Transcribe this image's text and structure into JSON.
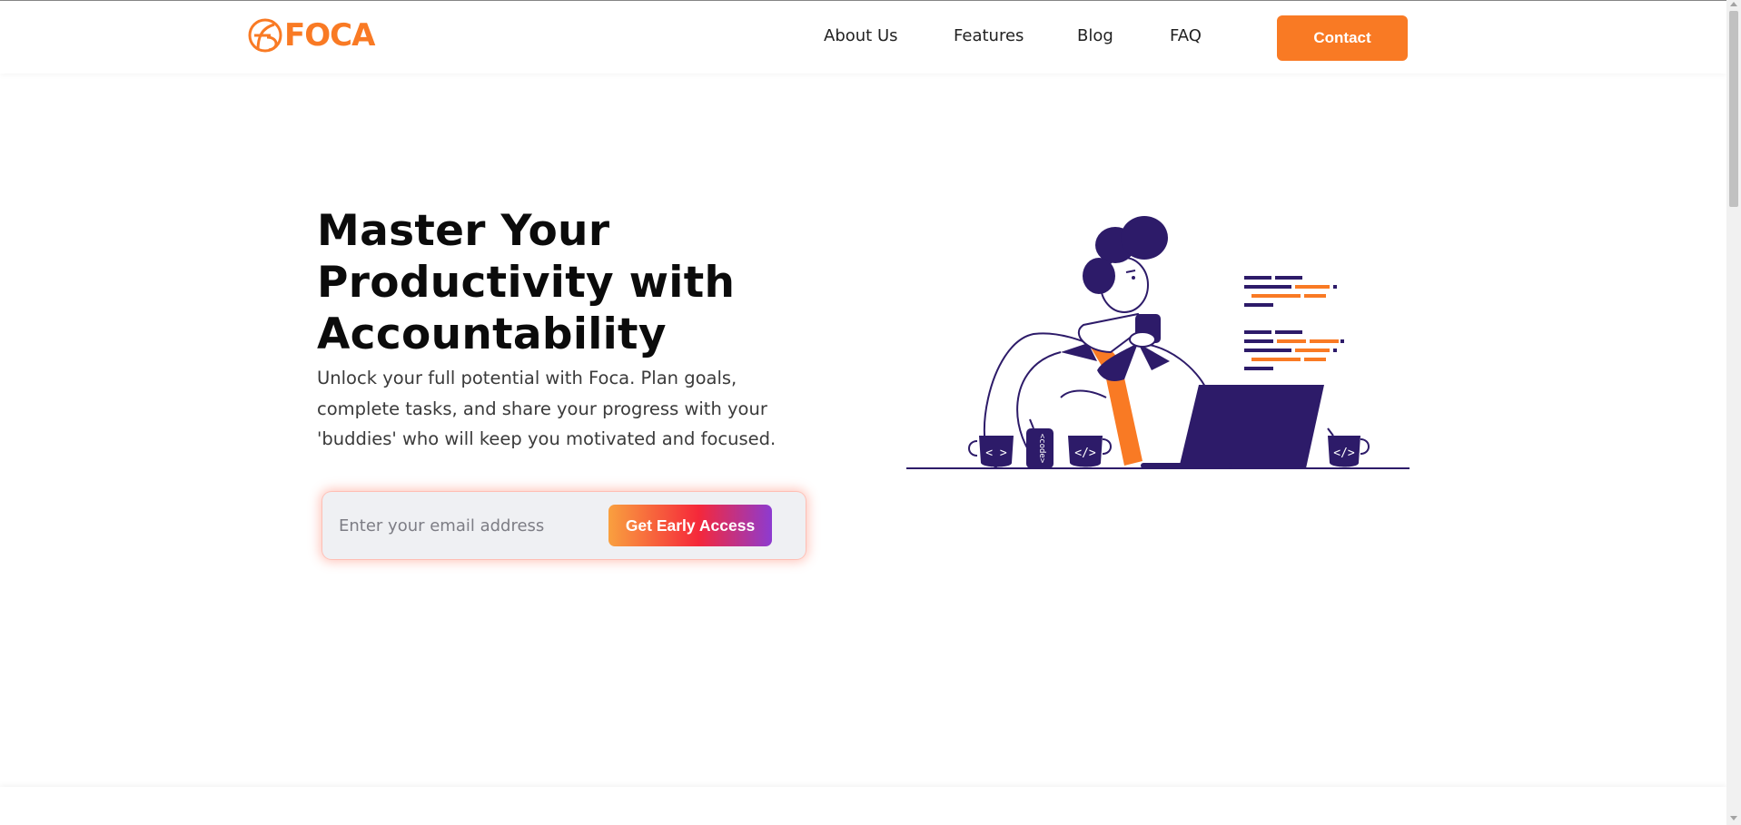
{
  "header": {
    "logo_text": "FOCA",
    "nav": {
      "about": "About Us",
      "features": "Features",
      "blog": "Blog",
      "faq": "FAQ"
    },
    "contact_label": "Contact"
  },
  "hero": {
    "title_lines": [
      "Master Your",
      "Productivity with",
      "Accountability"
    ],
    "subtitle": "Unlock your full potential with Foca. Plan goals, complete tasks, and share your progress with your 'buddies' who will keep you motivated and focused.",
    "email_placeholder": "Enter your email address",
    "cta_label": "Get Early Access"
  },
  "illustration": {
    "mug_labels": [
      "< >",
      "</>",
      "</>"
    ],
    "can_label": "<code>"
  },
  "colors": {
    "brand_orange": "#f97a24",
    "illustration_purple": "#2d1b69",
    "cta_gradient": [
      "#f9a03f",
      "#f5283a",
      "#8d3bd0"
    ]
  }
}
